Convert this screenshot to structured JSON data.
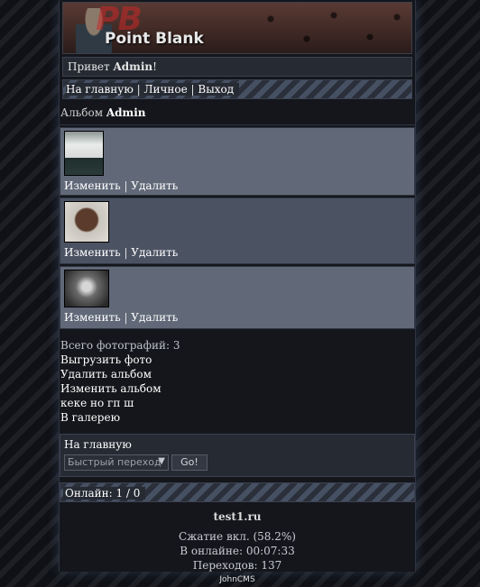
{
  "header": {
    "logo_text": "Point Blank",
    "logo_letters": "PB"
  },
  "greeting": {
    "prefix": "Привет ",
    "user": "Admin",
    "suffix": "!"
  },
  "nav": {
    "home": "На главную",
    "sep1": " | ",
    "personal": "Личное",
    "sep2": " | ",
    "logout": "Выход"
  },
  "album": {
    "title_prefix": "Альбом ",
    "owner": "Admin"
  },
  "photos": [
    {
      "edit": "Изменить",
      "sep": " | ",
      "delete": "Удалить"
    },
    {
      "edit": "Изменить",
      "sep": " | ",
      "delete": "Удалить"
    },
    {
      "edit": "Изменить",
      "sep": " | ",
      "delete": "Удалить"
    }
  ],
  "stats": {
    "total": "Всего фотографий: 3",
    "upload": "Выгрузить фото",
    "delete_album": "Удалить альбом",
    "edit_album": "Изменить альбом",
    "random": "кеке но гп ш",
    "gallery": "В галерею"
  },
  "footer_nav": {
    "home": "На главную",
    "select_value": "Быстрый переход",
    "go_button": "Go!"
  },
  "online": {
    "text": "Онлайн: 1 / 0"
  },
  "footer": {
    "site": "test1.ru",
    "compression": "Сжатие вкл. (58.2%)",
    "online_time": "В онлайне: 00:07:33",
    "transitions": "Переходов: 137",
    "cms": "JohnCMS"
  }
}
